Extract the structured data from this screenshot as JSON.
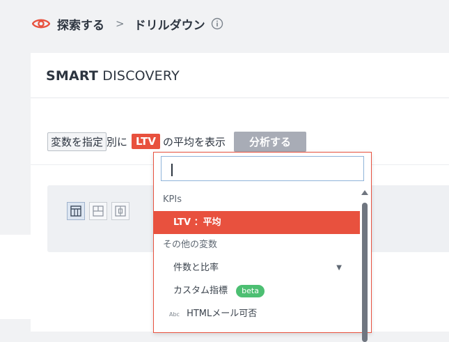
{
  "breadcrumb": {
    "root": "探索する",
    "separator": ">",
    "current": "ドリルダウン"
  },
  "card": {
    "title_bold": "SMART",
    "title_light": "DISCOVERY"
  },
  "sentence": {
    "variable_chip": "変数を指定",
    "by_text": "別に",
    "metric_chip": "LTV",
    "suffix": "の平均を表示",
    "analyze_button": "分析する"
  },
  "dropdown": {
    "search_value": "",
    "groups": [
      {
        "label": "KPIs",
        "items": [
          {
            "label": "LTV ：平均",
            "selected": true
          }
        ]
      },
      {
        "label": "その他の変数",
        "items": [
          {
            "label": "件数と比率",
            "expandable": true
          },
          {
            "label": "カスタム指標",
            "badge": "beta"
          },
          {
            "label": "HTMLメール可否",
            "type_prefix": "Abc"
          }
        ]
      }
    ]
  },
  "colors": {
    "accent": "#e8513e",
    "badge_green": "#4cbf72",
    "button_gray": "#a8acb6"
  }
}
